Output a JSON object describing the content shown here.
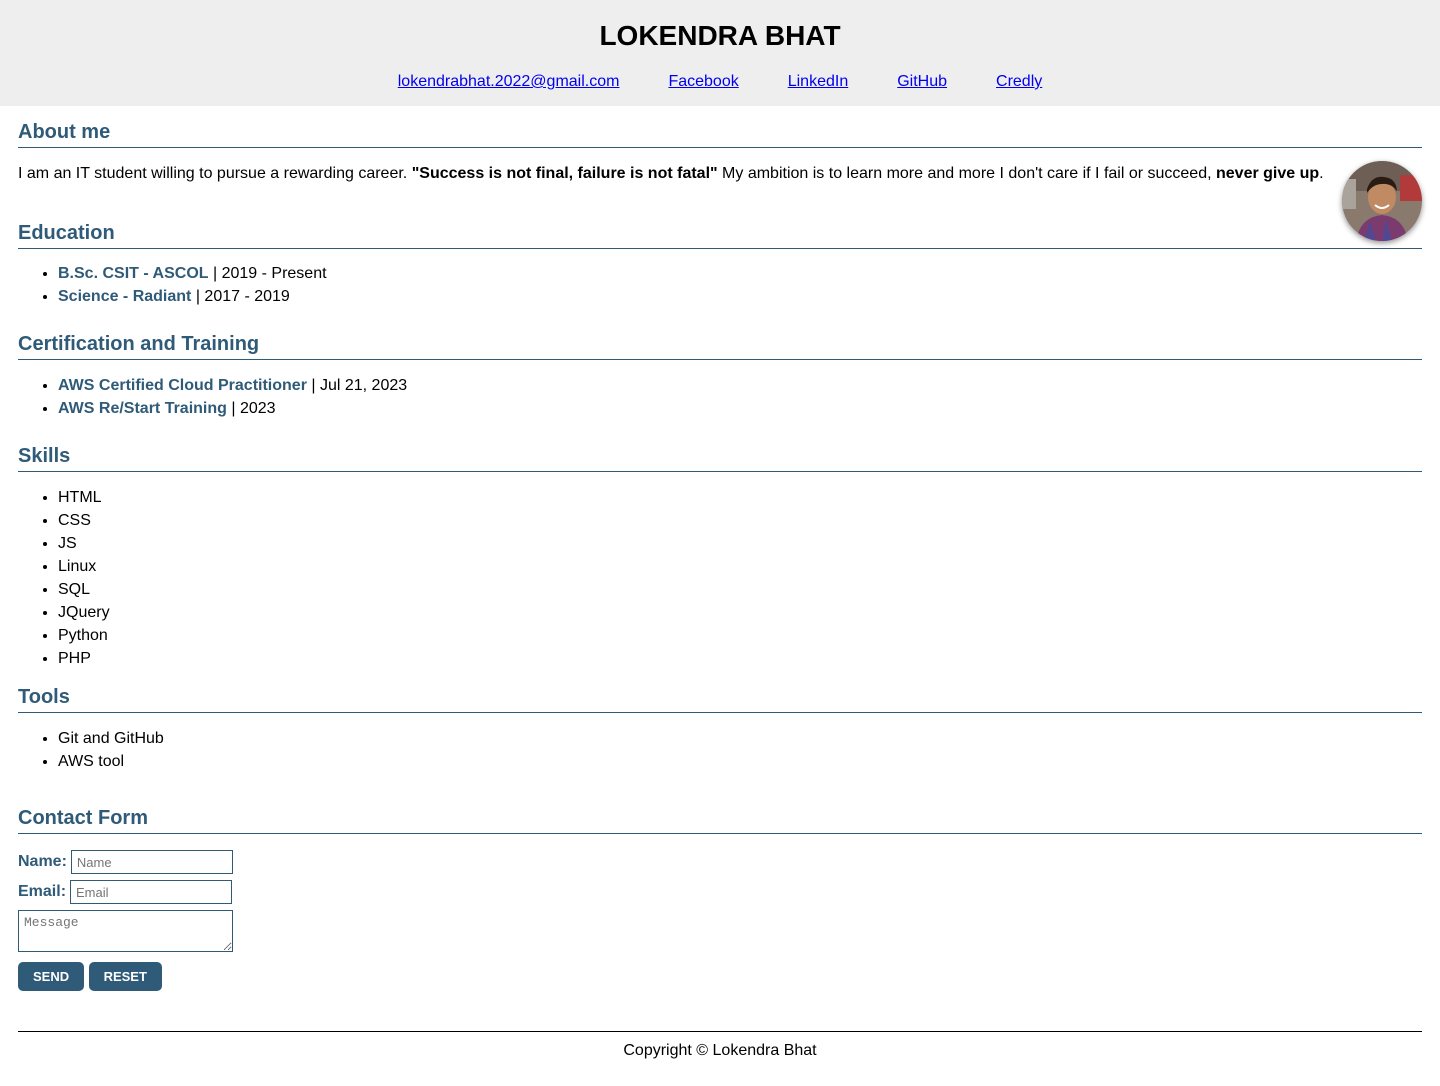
{
  "header": {
    "name": "LOKENDRA BHAT",
    "links": [
      "lokendrabhat.2022@gmail.com",
      "Facebook",
      "LinkedIn",
      "GitHub",
      "Credly"
    ]
  },
  "about": {
    "title": "About me",
    "text1": "I am an IT student willing to pursue a rewarding career. ",
    "quote": "\"Success is not final, failure is not fatal\"",
    "text2": " My ambition is to learn more and more I don't care if I fail or succeed, ",
    "emphasis": "never give up",
    "text3": "."
  },
  "education": {
    "title": "Education",
    "items": [
      {
        "name": "B.Sc. CSIT - ASCOL",
        "meta": " | 2019 - Present"
      },
      {
        "name": "Science - Radiant",
        "meta": " | 2017 - 2019"
      }
    ]
  },
  "certification": {
    "title": "Certification and Training",
    "items": [
      {
        "name": "AWS Certified Cloud Practitioner",
        "meta": " | Jul 21, 2023"
      },
      {
        "name": "AWS Re/Start Training",
        "meta": " | 2023"
      }
    ]
  },
  "skills": {
    "title": "Skills",
    "items": [
      "HTML",
      "CSS",
      "JS",
      "Linux",
      "SQL",
      "JQuery",
      "Python",
      "PHP"
    ]
  },
  "tools": {
    "title": "Tools",
    "items": [
      "Git and GitHub",
      "AWS tool"
    ]
  },
  "contact": {
    "title": "Contact Form",
    "name_label": "Name:",
    "name_placeholder": "Name",
    "email_label": "Email:",
    "email_placeholder": "Email",
    "message_placeholder": "Message",
    "send_label": "Send",
    "reset_label": "Reset"
  },
  "footer": {
    "copyright": "Copyright © Lokendra Bhat"
  },
  "colors": {
    "accent": "#2f5a78",
    "header_bg": "#eeeeee",
    "link": "#0000ee"
  }
}
